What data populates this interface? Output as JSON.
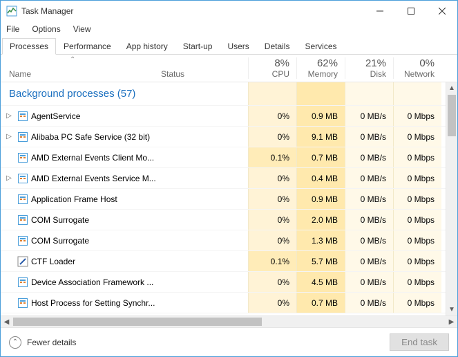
{
  "window": {
    "title": "Task Manager"
  },
  "menu": {
    "file": "File",
    "options": "Options",
    "view": "View"
  },
  "tabs": {
    "processes": "Processes",
    "performance": "Performance",
    "history": "App history",
    "startup": "Start-up",
    "users": "Users",
    "details": "Details",
    "services": "Services"
  },
  "headers": {
    "name": "Name",
    "status": "Status",
    "cpu_pct": "8%",
    "cpu": "CPU",
    "mem_pct": "62%",
    "mem": "Memory",
    "disk_pct": "21%",
    "disk": "Disk",
    "net_pct": "0%",
    "net": "Network"
  },
  "group": {
    "label": "Background processes (57)"
  },
  "rows": [
    {
      "expand": true,
      "name": "AgentService",
      "cpu": "0%",
      "cpu_nz": false,
      "mem": "0.9 MB",
      "disk": "0 MB/s",
      "net": "0 Mbps"
    },
    {
      "expand": true,
      "name": "Alibaba PC Safe Service (32 bit)",
      "cpu": "0%",
      "cpu_nz": false,
      "mem": "9.1 MB",
      "disk": "0 MB/s",
      "net": "0 Mbps"
    },
    {
      "expand": false,
      "name": "AMD External Events Client Mo...",
      "cpu": "0.1%",
      "cpu_nz": true,
      "mem": "0.7 MB",
      "disk": "0 MB/s",
      "net": "0 Mbps"
    },
    {
      "expand": true,
      "name": "AMD External Events Service M...",
      "cpu": "0%",
      "cpu_nz": false,
      "mem": "0.4 MB",
      "disk": "0 MB/s",
      "net": "0 Mbps"
    },
    {
      "expand": false,
      "name": "Application Frame Host",
      "cpu": "0%",
      "cpu_nz": false,
      "mem": "0.9 MB",
      "disk": "0 MB/s",
      "net": "0 Mbps"
    },
    {
      "expand": false,
      "name": "COM Surrogate",
      "cpu": "0%",
      "cpu_nz": false,
      "mem": "2.0 MB",
      "disk": "0 MB/s",
      "net": "0 Mbps"
    },
    {
      "expand": false,
      "name": "COM Surrogate",
      "cpu": "0%",
      "cpu_nz": false,
      "mem": "1.3 MB",
      "disk": "0 MB/s",
      "net": "0 Mbps"
    },
    {
      "expand": false,
      "name": "CTF Loader",
      "cpu": "0.1%",
      "cpu_nz": true,
      "mem": "5.7 MB",
      "disk": "0 MB/s",
      "net": "0 Mbps",
      "pen": true
    },
    {
      "expand": false,
      "name": "Device Association Framework ...",
      "cpu": "0%",
      "cpu_nz": false,
      "mem": "4.5 MB",
      "disk": "0 MB/s",
      "net": "0 Mbps"
    },
    {
      "expand": false,
      "name": "Host Process for Setting Synchr...",
      "cpu": "0%",
      "cpu_nz": false,
      "mem": "0.7 MB",
      "disk": "0 MB/s",
      "net": "0 Mbps"
    }
  ],
  "footer": {
    "fewer": "Fewer details",
    "endtask": "End task"
  }
}
